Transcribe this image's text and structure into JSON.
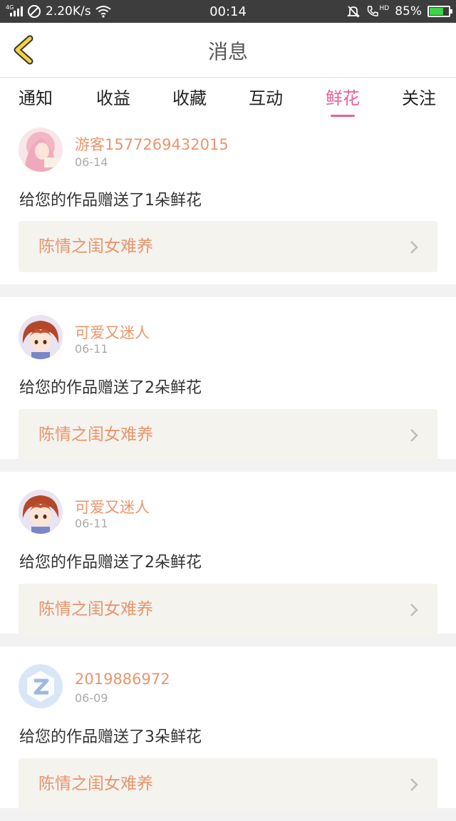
{
  "status_bar": {
    "network_type": "4G",
    "speed": "2.20K/s",
    "time": "00:14",
    "hd_label": "HD",
    "battery": "85%",
    "battery_level": 0.85
  },
  "header": {
    "title": "消息"
  },
  "tabs": [
    {
      "label": "通知",
      "active": false
    },
    {
      "label": "收益",
      "active": false
    },
    {
      "label": "收藏",
      "active": false
    },
    {
      "label": "互动",
      "active": false
    },
    {
      "label": "鲜花",
      "active": true
    },
    {
      "label": "关注",
      "active": false
    }
  ],
  "messages": [
    {
      "user": "游客1577269432015",
      "date": "06-14",
      "text": "给您的作品赠送了1朵鲜花",
      "work": "陈情之闺女难养",
      "avatar": "anime-pink-hair"
    },
    {
      "user": "可爱又迷人",
      "date": "06-11",
      "text": "给您的作品赠送了2朵鲜花",
      "work": "陈情之闺女难养",
      "avatar": "anime-red-hair"
    },
    {
      "user": "可爱又迷人",
      "date": "06-11",
      "text": "给您的作品赠送了2朵鲜花",
      "work": "陈情之闺女难养",
      "avatar": "anime-red-hair"
    },
    {
      "user": "2019886972",
      "date": "06-09",
      "text": "给您的作品赠送了3朵鲜花",
      "work": "陈情之闺女难养",
      "avatar": "default-z-logo"
    }
  ],
  "colors": {
    "accent": "#e8609a",
    "username": "#e9956c",
    "work_bg": "#f4f3ee",
    "back_arrow": "#f6d33d"
  }
}
